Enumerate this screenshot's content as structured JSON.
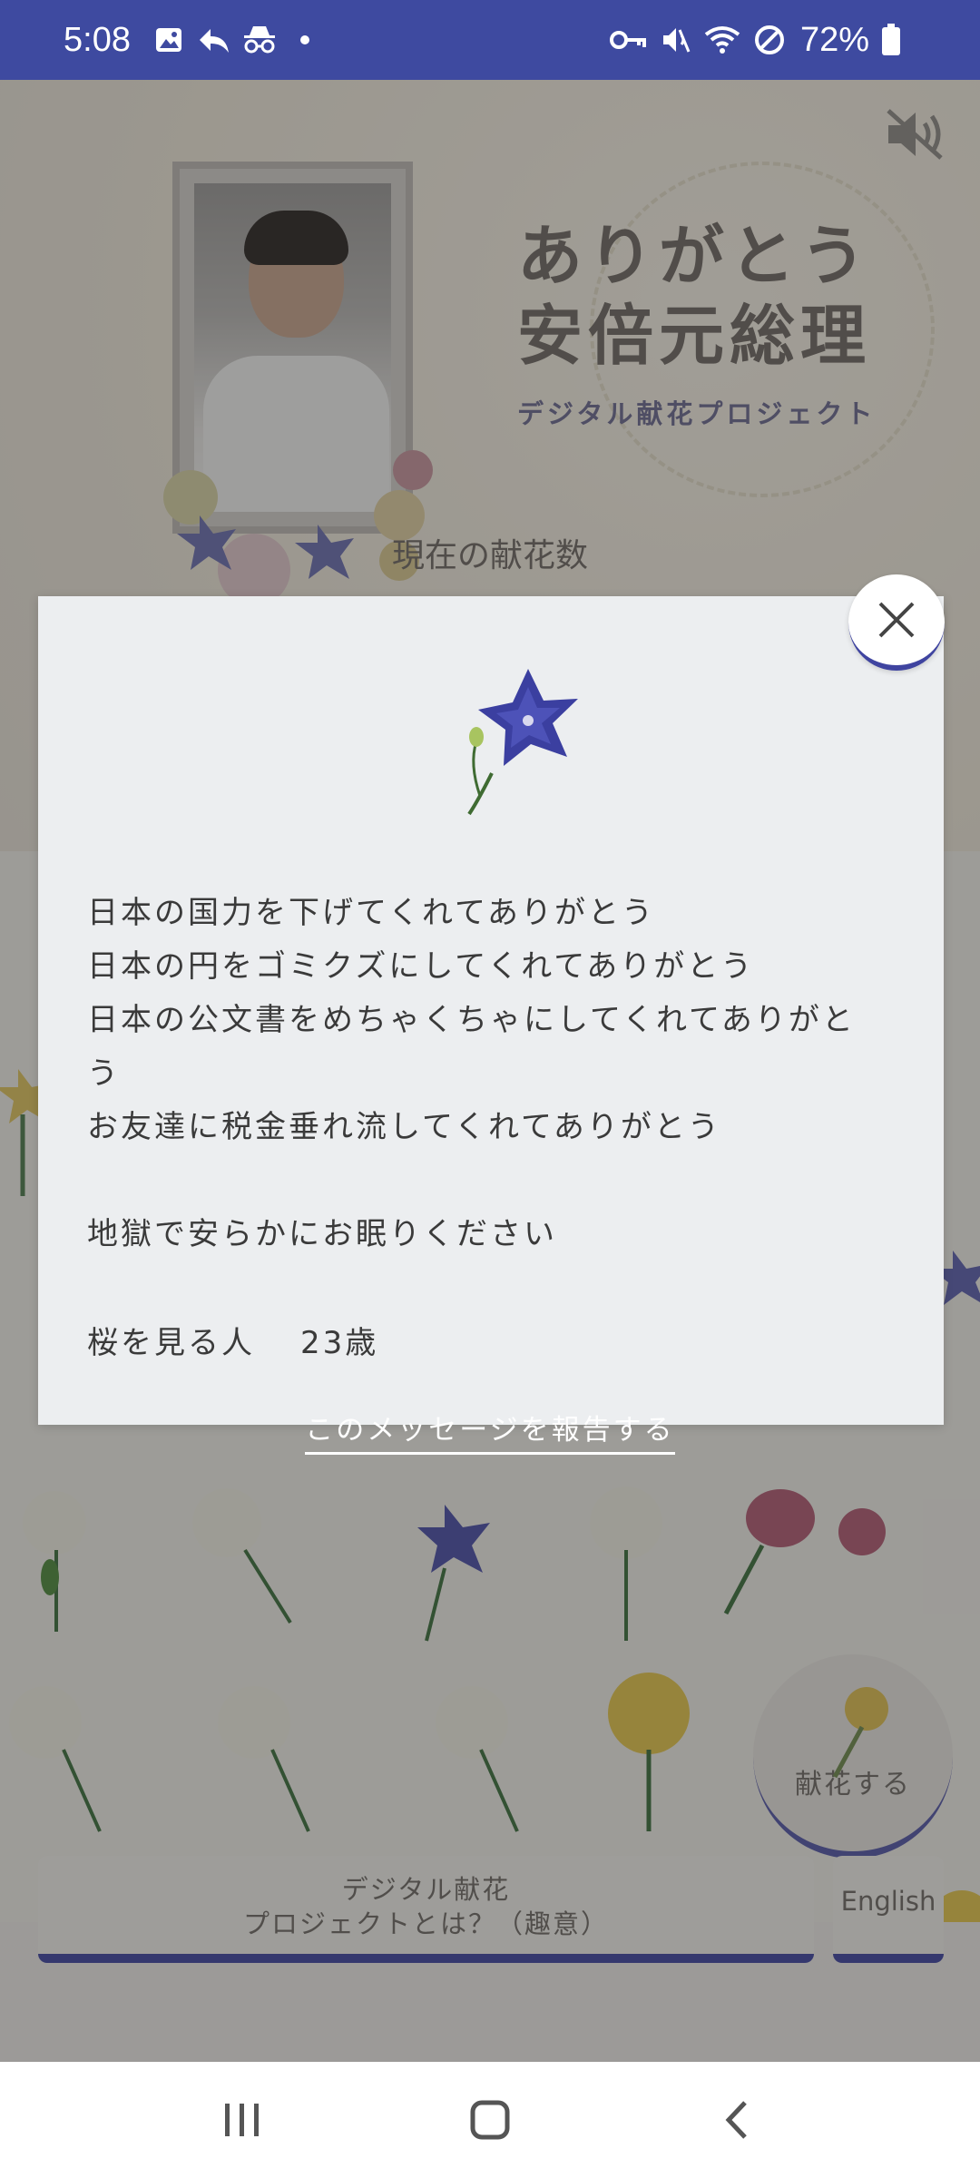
{
  "status_bar": {
    "time": "5:08",
    "battery": "72%",
    "icons_left": [
      "gallery-icon",
      "reply-icon",
      "incognito-icon",
      "dot-icon"
    ],
    "icons_right": [
      "vpn-key-icon",
      "mute-icon",
      "wifi-icon",
      "do-not-disturb-icon",
      "battery-icon"
    ]
  },
  "hero": {
    "title_line1": "ありがとう",
    "title_line2": "安倍元総理",
    "subtitle": "デジタル献花プロジェクト",
    "count_label": "現在の献花数"
  },
  "modal": {
    "message": "日本の国力を下げてくれてありがとう\n日本の円をゴミクズにしてくれてありがとう\n日本の公文書をめちゃくちゃにしてくれてありがと\nう\nお友達に税金垂れ流してくれてありがとう\n\n地獄で安らかにお眠りください",
    "author": "桜を見る人",
    "age": "23歳"
  },
  "report_link": "このメッセージを報告する",
  "donate_button": "献花する",
  "about_button_line1": "デジタル献花",
  "about_button_line2": "プロジェクトとは？（趣意）",
  "language_button": "English",
  "colors": {
    "status_bar": "#3e4aa0",
    "accent": "#3f44a0",
    "modal_bg": "#eceef0",
    "text": "#3a3a3a"
  }
}
